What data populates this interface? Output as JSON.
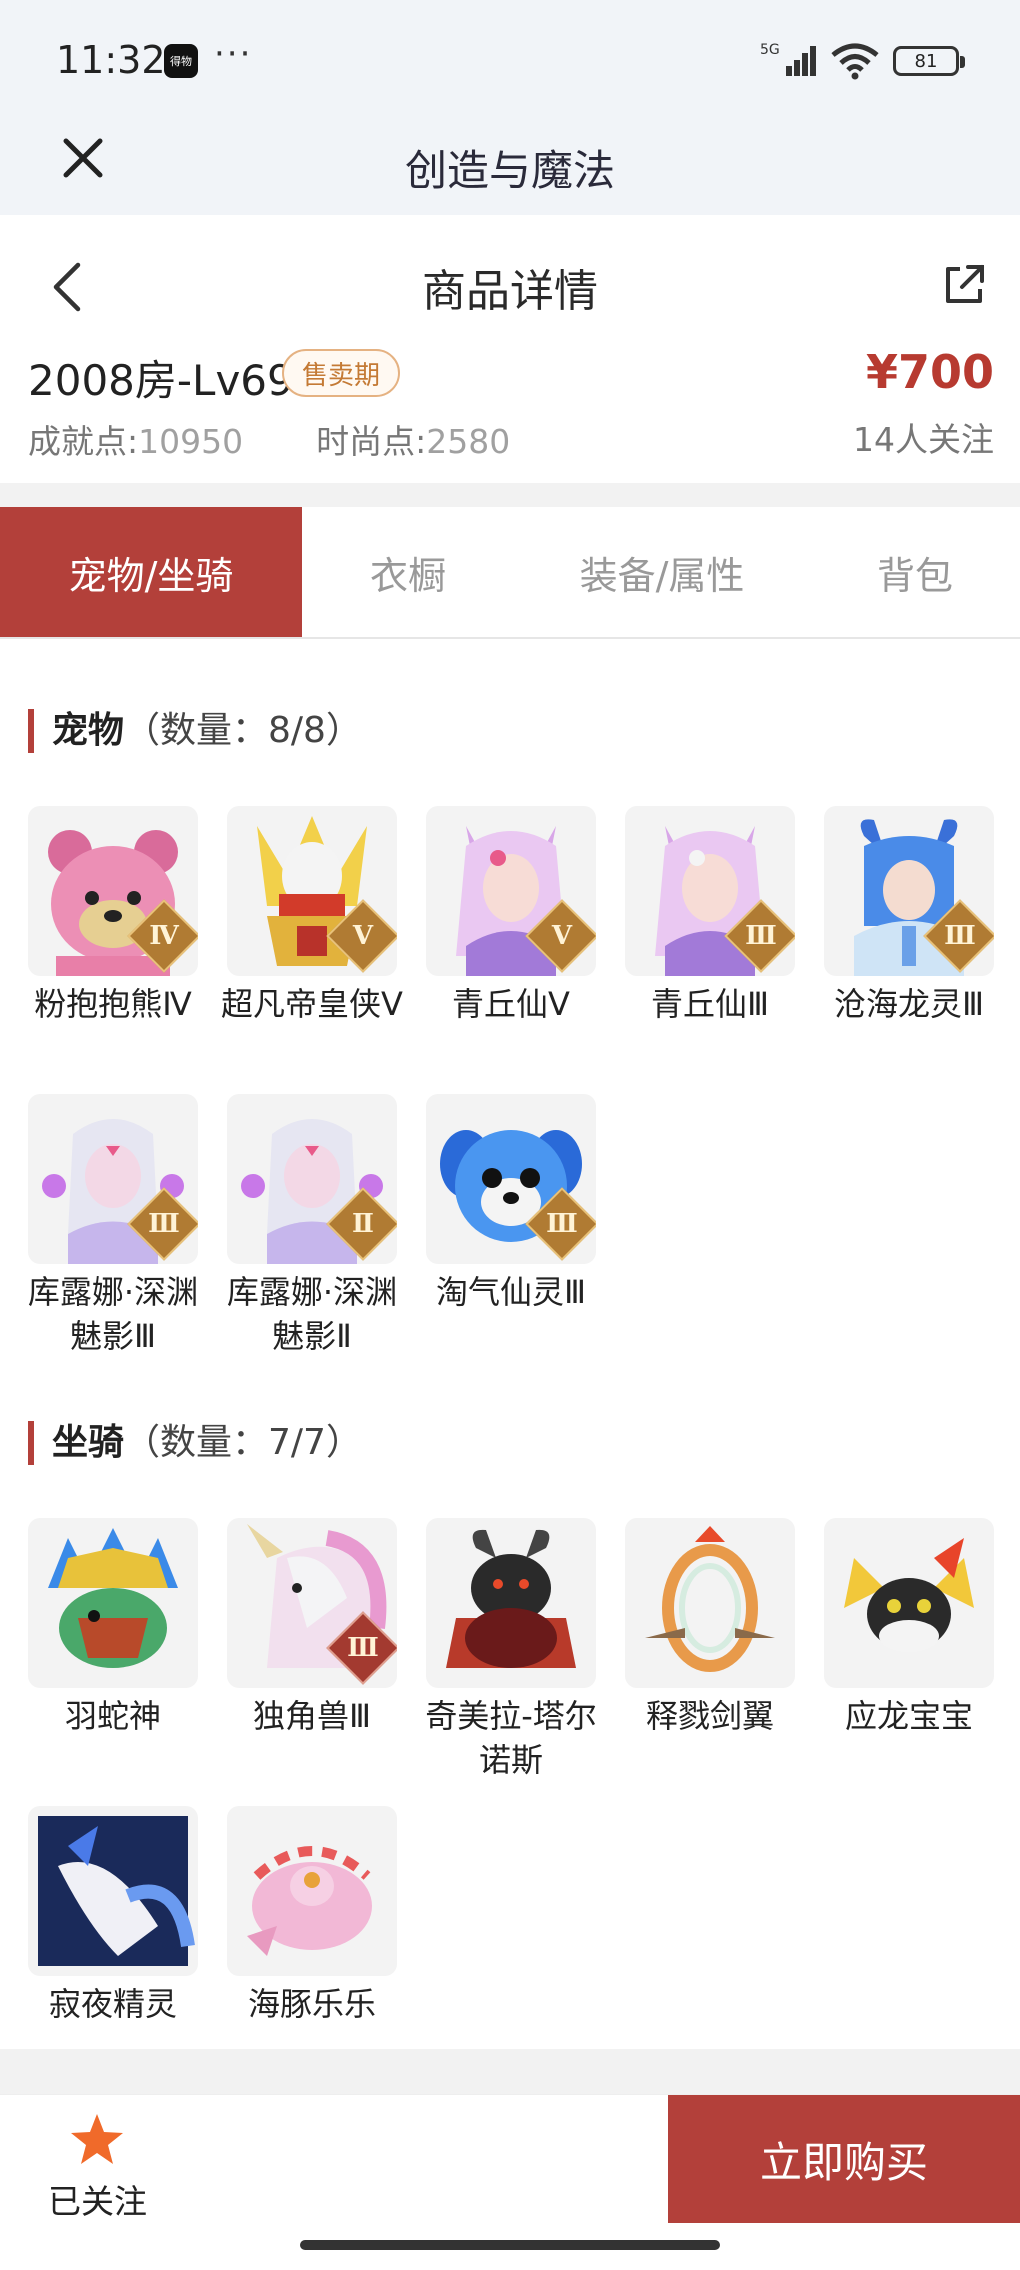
{
  "status_bar": {
    "time": "11:32",
    "app_icon_label": "得物",
    "dots": "···",
    "battery": "81"
  },
  "header": {
    "title": "创造与魔法"
  },
  "detail": {
    "page_title": "商品详情",
    "product_name": "2008房-Lv69",
    "sale_badge": "售卖期",
    "price": "¥700",
    "achievement_label": "成就点:",
    "achievement_value": "10950",
    "fashion_label": "时尚点:",
    "fashion_value": "2580",
    "followers": "14人关注"
  },
  "tabs": [
    {
      "label": "宠物/坐骑",
      "active": true
    },
    {
      "label": "衣橱",
      "active": false
    },
    {
      "label": "装备/属性",
      "active": false
    },
    {
      "label": "背包",
      "active": false
    }
  ],
  "pets": {
    "title": "宠物",
    "count": "（数量：8/8）",
    "items": [
      {
        "name": "粉抱抱熊Ⅳ",
        "rank": "Ⅳ"
      },
      {
        "name": "超凡帝皇侠Ⅴ",
        "rank": "Ⅴ"
      },
      {
        "name": "青丘仙Ⅴ",
        "rank": "Ⅴ"
      },
      {
        "name": "青丘仙Ⅲ",
        "rank": "Ⅲ"
      },
      {
        "name": "沧海龙灵Ⅲ",
        "rank": "Ⅲ"
      },
      {
        "name": "库露娜·深渊魅影Ⅲ",
        "rank": "Ⅲ"
      },
      {
        "name": "库露娜·深渊魅影Ⅱ",
        "rank": "Ⅱ"
      },
      {
        "name": "淘气仙灵Ⅲ",
        "rank": "Ⅲ"
      }
    ]
  },
  "mounts": {
    "title": "坐骑",
    "count": "（数量：7/7）",
    "items": [
      {
        "name": "羽蛇神",
        "rank": ""
      },
      {
        "name": "独角兽Ⅲ",
        "rank": "Ⅲ"
      },
      {
        "name": "奇美拉-塔尔诺斯",
        "rank": ""
      },
      {
        "name": "释戮剑翼",
        "rank": ""
      },
      {
        "name": "应龙宝宝",
        "rank": ""
      },
      {
        "name": "寂夜精灵",
        "rank": ""
      },
      {
        "name": "海豚乐乐",
        "rank": ""
      }
    ]
  },
  "bottom_bar": {
    "follow_label": "已关注",
    "buy_label": "立即购买"
  },
  "colors": {
    "accent": "#b3403a",
    "price": "#b73a30",
    "badge": "#c47a35"
  }
}
